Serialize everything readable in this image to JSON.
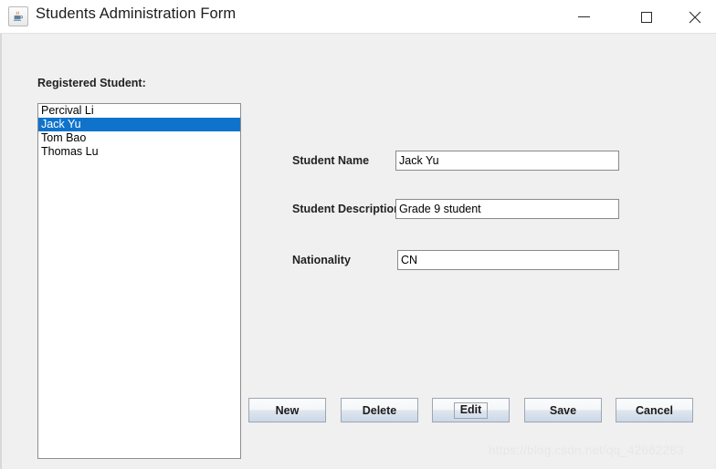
{
  "window": {
    "title": "Students Administration Form",
    "icon": "java-coffee-cup-icon",
    "controls": {
      "minimize": "minimize-icon",
      "maximize": "maximize-icon",
      "close": "✕"
    }
  },
  "list_section": {
    "label": "Registered Student:",
    "items": [
      {
        "name": "Percival Li",
        "selected": false
      },
      {
        "name": "Jack Yu",
        "selected": true
      },
      {
        "name": "Tom Bao",
        "selected": false
      },
      {
        "name": "Thomas Lu",
        "selected": false
      }
    ],
    "selection_color": "#0f73cb"
  },
  "form": {
    "fields": [
      {
        "label": "Student Name",
        "value": "Jack Yu",
        "placeholder": ""
      },
      {
        "label": "Student Description",
        "value": "Grade 9 student",
        "placeholder": ""
      },
      {
        "label": "Nationality",
        "value": "CN",
        "placeholder": ""
      }
    ]
  },
  "buttons": [
    {
      "label": "New",
      "focused": false
    },
    {
      "label": "Delete",
      "focused": false
    },
    {
      "label": "Edit",
      "focused": true
    },
    {
      "label": "Save",
      "focused": false
    },
    {
      "label": "Cancel",
      "focused": false
    }
  ],
  "watermark": "https://blog.csdn.net/qq_42662283"
}
